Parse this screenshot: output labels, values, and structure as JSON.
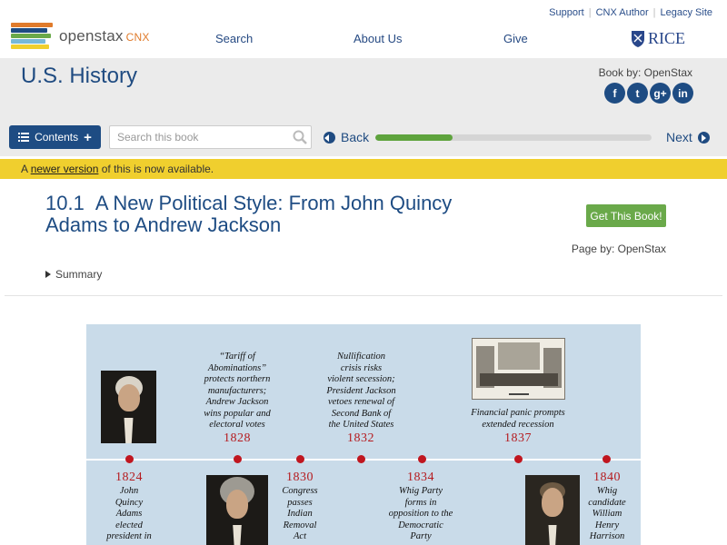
{
  "utility_links": [
    "Support",
    "CNX Author",
    "Legacy Site"
  ],
  "logo": {
    "text": "openstax",
    "suffix": "CNX"
  },
  "nav": {
    "search": "Search",
    "about": "About Us",
    "give": "Give"
  },
  "partner": "RICE",
  "book": {
    "title": "U.S. History",
    "by_label": "Book by: OpenStax",
    "social": [
      {
        "icon": "facebook-icon",
        "glyph": "f"
      },
      {
        "icon": "twitter-icon",
        "glyph": "t"
      },
      {
        "icon": "google-plus-icon",
        "glyph": "g+"
      },
      {
        "icon": "linkedin-icon",
        "glyph": "in"
      }
    ]
  },
  "toolbar": {
    "contents_label": "Contents",
    "search_placeholder": "Search this book",
    "back_label": "Back",
    "next_label": "Next",
    "progress_fraction": 0.28
  },
  "notice": {
    "prefix": "A ",
    "link": "newer version",
    "suffix": " of this is now available."
  },
  "section": {
    "number": "10.1",
    "title": "A New Political Style: From John Quincy Adams to Andrew Jackson",
    "get_book": "Get This Book!",
    "page_by": "Page by: OpenStax",
    "summary": "Summary"
  },
  "timeline": {
    "colors": {
      "background": "#c9dbe9",
      "year": "#b51b1f",
      "dot": "#c0161f"
    },
    "top_events": [
      {
        "year": "1828",
        "lines": [
          "“Tariff of",
          "Abominations”",
          "protects northern",
          "manufacturers;",
          "Andrew Jackson",
          "wins popular and",
          "electoral votes"
        ]
      },
      {
        "year": "1832",
        "lines": [
          "Nullification",
          "crisis risks",
          "violent secession;",
          "President Jackson",
          "vetoes renewal of",
          "Second Bank of",
          "the United States"
        ]
      },
      {
        "year": "1837",
        "lines": [
          "Financial panic prompts",
          "extended recession"
        ]
      }
    ],
    "bottom_events": [
      {
        "year": "1824",
        "lines": [
          "John",
          "Quincy",
          "Adams",
          "elected",
          "president in"
        ]
      },
      {
        "year": "1830",
        "lines": [
          "Congress",
          "passes",
          "Indian",
          "Removal",
          "Act"
        ]
      },
      {
        "year": "1834",
        "lines": [
          "Whig Party",
          "forms in",
          "opposition to the",
          "Democratic",
          "Party"
        ]
      },
      {
        "year": "1840",
        "lines": [
          "Whig",
          "candidate",
          "William",
          "Henry",
          "Harrison"
        ]
      }
    ]
  }
}
